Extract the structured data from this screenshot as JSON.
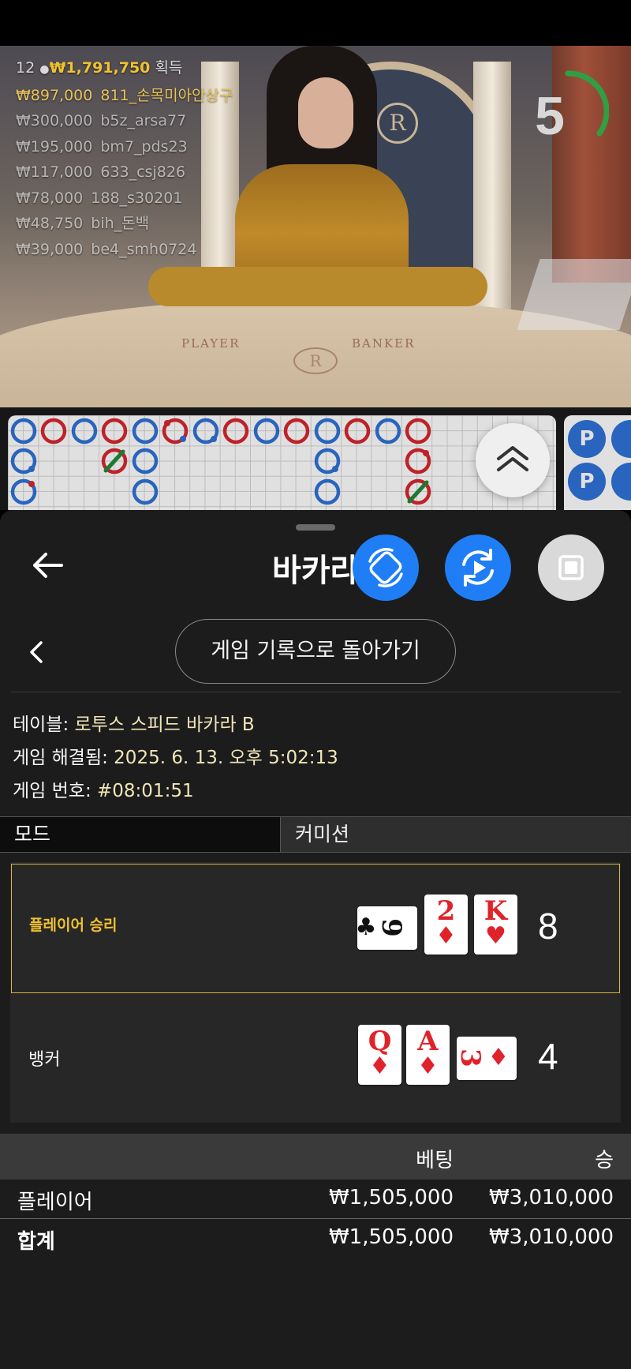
{
  "leaderboard": {
    "count": "12",
    "total": "₩1,791,750",
    "suffix": "획득",
    "entries": [
      {
        "amount": "₩897,000",
        "user": "811_손목미아안상구"
      },
      {
        "amount": "₩300,000",
        "user": "b5z_arsa77"
      },
      {
        "amount": "₩195,000",
        "user": "bm7_pds23"
      },
      {
        "amount": "₩117,000",
        "user": "633_csj826"
      },
      {
        "amount": "₩78,000",
        "user": "188_s30201"
      },
      {
        "amount": "₩48,750",
        "user": "bih_돈백"
      },
      {
        "amount": "₩39,000",
        "user": "be4_smh0724"
      }
    ]
  },
  "timer": {
    "value": "5",
    "color": "#2ea043"
  },
  "table_felt": {
    "player": "PLAYER",
    "banker": "BANKER",
    "logo": "R"
  },
  "bead_road": {
    "labels": [
      "P",
      "P"
    ]
  },
  "sheet": {
    "title": "바카라",
    "back_to_history": "게임 기록으로 돌아가기",
    "table_label": "테이블: ",
    "table_value": "로투스 스피드 바카라 B",
    "resolved_label": "게임 해결됨: ",
    "resolved_value": "2025. 6. 13. 오후 5:02:13",
    "game_no_label": "게임 번호: ",
    "game_no_value": "#08:01:51"
  },
  "tabs": {
    "mode": "모드",
    "commission": "커미션"
  },
  "results": {
    "player": {
      "label": "플레이어 승리",
      "score": "8",
      "cards": [
        {
          "rank": "9",
          "suit": "♣",
          "color": "black",
          "rotated": true
        },
        {
          "rank": "2",
          "suit": "♦",
          "color": "red",
          "rotated": false
        },
        {
          "rank": "K",
          "suit": "♥",
          "color": "red",
          "rotated": false
        }
      ]
    },
    "banker": {
      "label": "뱅커",
      "score": "4",
      "cards": [
        {
          "rank": "Q",
          "suit": "♦",
          "color": "red",
          "rotated": false
        },
        {
          "rank": "A",
          "suit": "♦",
          "color": "red",
          "rotated": false
        },
        {
          "rank": "3",
          "suit": "♦",
          "color": "red",
          "rotated": true
        }
      ]
    }
  },
  "bets": {
    "header_bet": "베팅",
    "header_win": "승",
    "rows": [
      {
        "name": "플레이어",
        "bet": "₩1,505,000",
        "win": "₩3,010,000"
      }
    ],
    "total": {
      "name": "합계",
      "bet": "₩1,505,000",
      "win": "₩3,010,000"
    }
  },
  "colors": {
    "accent_blue": "#1f7ef5",
    "gold": "#f0c230",
    "player_blue": "#2f72d9",
    "banker_red": "#d9272e"
  }
}
